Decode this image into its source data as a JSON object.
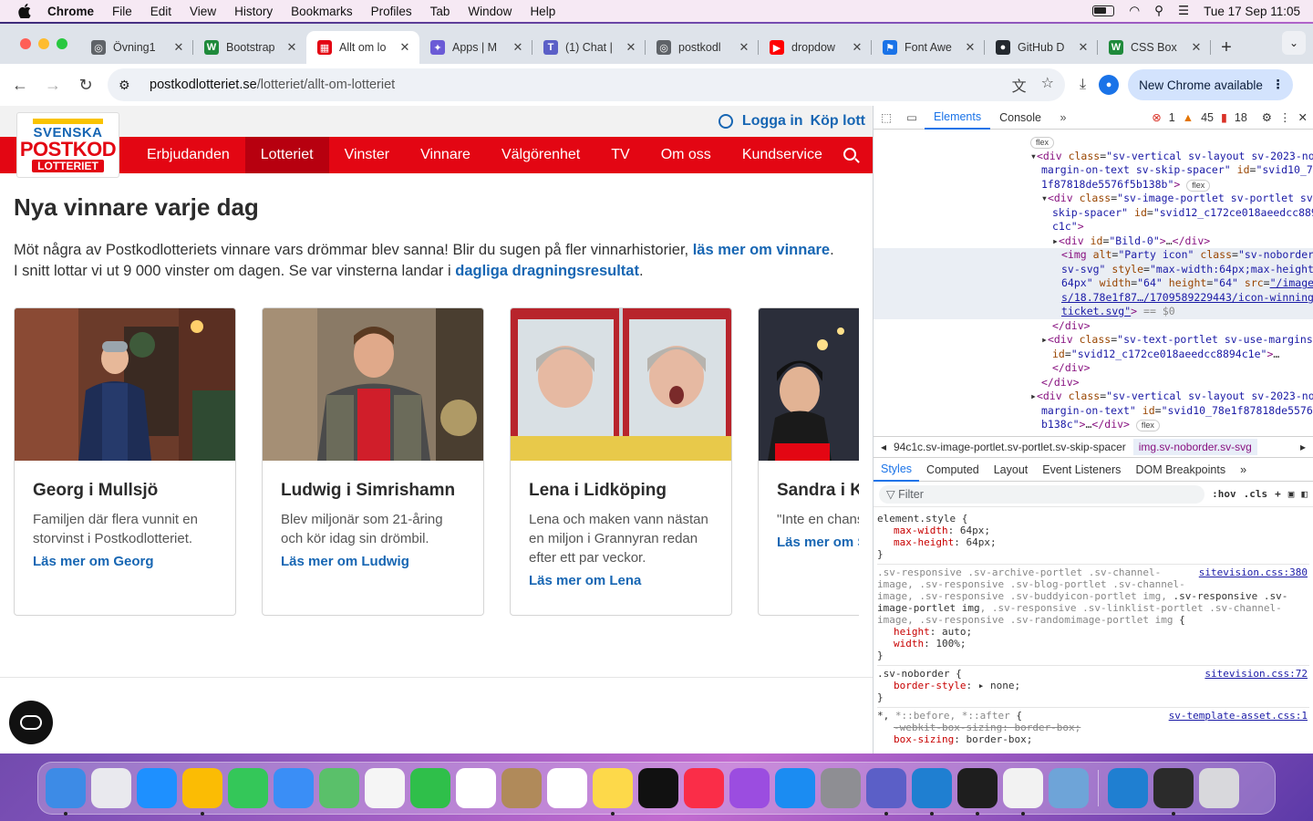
{
  "menubar": {
    "app": "Chrome",
    "items": [
      "File",
      "Edit",
      "View",
      "History",
      "Bookmarks",
      "Profiles",
      "Tab",
      "Window",
      "Help"
    ],
    "clock": "Tue 17 Sep  11:05"
  },
  "tabs": [
    {
      "label": "Övning1",
      "color": "#5f6368",
      "glyph": "◎"
    },
    {
      "label": "Bootstrap",
      "color": "#1f8a3b",
      "glyph": "W"
    },
    {
      "label": "Allt om lo",
      "color": "#e30613",
      "glyph": "▦"
    },
    {
      "label": "Apps | M",
      "color": "#6b5bd6",
      "glyph": "✦"
    },
    {
      "label": "(1) Chat |",
      "color": "#5b5fc7",
      "glyph": "T"
    },
    {
      "label": "postkodl",
      "color": "#5f6368",
      "glyph": "◎"
    },
    {
      "label": "dropdow",
      "color": "#ff0000",
      "glyph": "▶"
    },
    {
      "label": "Font Awe",
      "color": "#1a73e8",
      "glyph": "⚑"
    },
    {
      "label": "GitHub D",
      "color": "#24292f",
      "glyph": "●"
    },
    {
      "label": "CSS Box",
      "color": "#1f8a3b",
      "glyph": "W"
    }
  ],
  "toolbar": {
    "url_host": "postkodlotteriet.se",
    "url_path": "/lotteriet/allt-om-lotteriet",
    "new_chrome": "New Chrome available"
  },
  "site": {
    "logo": {
      "line1": "SVENSKA",
      "line2": "POSTKOD",
      "line3": "LOTTERIET"
    },
    "login": "Logga in",
    "buy": "Köp lott",
    "nav": [
      "Erbjudanden",
      "Lotteriet",
      "Vinster",
      "Vinnare",
      "Välgörenhet",
      "TV",
      "Om oss",
      "Kundservice"
    ],
    "heading": "Nya vinnare varje dag",
    "intro1": "Möt några av Postkodlotteriets vinnare vars drömmar blev sanna! Blir du sugen på fler vinnarhistorier, ",
    "intro1_link": "läs mer om vinnare",
    "intro1_end": ".",
    "intro2": "I snitt lottar vi ut 9 000 vinster om dagen. Se var vinsterna landar i ",
    "intro2_link": "dagliga dragningsresultat",
    "intro2_end": ".",
    "cards": [
      {
        "title": "Georg i Mullsjö",
        "desc": "Familjen där flera vunnit en storvinst i Postkodlotteriet.",
        "link": "Läs mer om Georg"
      },
      {
        "title": "Ludwig i Simrishamn",
        "desc": "Blev miljonär som 21-åring och kör idag sin drömbil.",
        "link": "Läs mer om Ludwig"
      },
      {
        "title": "Lena i Lidköping",
        "desc": "Lena och maken vann nästan en miljon i Grannyran redan efter ett par veckor.",
        "link": "Läs mer om Lena"
      },
      {
        "title": "Sandra i Ka",
        "desc": "\"Inte en chans vinna igen.\"",
        "link": "Läs mer om S"
      }
    ]
  },
  "devtools": {
    "tabs": [
      "Elements",
      "Console"
    ],
    "errors": "1",
    "warnings": "45",
    "issues": "18",
    "crumb1": "94c1c.sv-image-portlet.sv-portlet.sv-skip-spacer",
    "crumb2": "img.sv-noborder.sv-svg",
    "subtabs": [
      "Styles",
      "Computed",
      "Layout",
      "Event Listeners",
      "DOM Breakpoints"
    ],
    "filter": "Filter",
    "hov": ":hov",
    "cls": ".cls",
    "sources": [
      "sitevision.css:380",
      "sitevision.css:72",
      "sv-template-asset.css:1"
    ]
  },
  "dock": [
    {
      "name": "finder",
      "color": "#3d8be6"
    },
    {
      "name": "launchpad",
      "color": "#e9e9ee"
    },
    {
      "name": "safari",
      "color": "#1e90ff"
    },
    {
      "name": "chrome",
      "color": "#fbbc04"
    },
    {
      "name": "messages",
      "color": "#34c759"
    },
    {
      "name": "mail",
      "color": "#3a8ef6"
    },
    {
      "name": "maps",
      "color": "#5ac06a"
    },
    {
      "name": "photos",
      "color": "#f5f5f5"
    },
    {
      "name": "facetime",
      "color": "#2fbf4a"
    },
    {
      "name": "calendar",
      "color": "#ffffff"
    },
    {
      "name": "contacts",
      "color": "#b08a5a"
    },
    {
      "name": "reminders",
      "color": "#ffffff"
    },
    {
      "name": "notes",
      "color": "#fdd94a"
    },
    {
      "name": "tv",
      "color": "#111111"
    },
    {
      "name": "music",
      "color": "#fa2d48"
    },
    {
      "name": "podcasts",
      "color": "#9b4de0"
    },
    {
      "name": "app-store",
      "color": "#1b8cf2"
    },
    {
      "name": "system-settings",
      "color": "#8e8e93"
    },
    {
      "name": "teams",
      "color": "#5b5fc7"
    },
    {
      "name": "vscode",
      "color": "#1f7fd1"
    },
    {
      "name": "terminal",
      "color": "#1e1e1e"
    },
    {
      "name": "textedit",
      "color": "#f2f2f2"
    },
    {
      "name": "preview",
      "color": "#6ea4d8"
    },
    {
      "name": "vscode-2",
      "color": "#1f7fd1"
    },
    {
      "name": "screen-window",
      "color": "#2b2b2b"
    },
    {
      "name": "trash",
      "color": "#d8d8dc"
    }
  ]
}
